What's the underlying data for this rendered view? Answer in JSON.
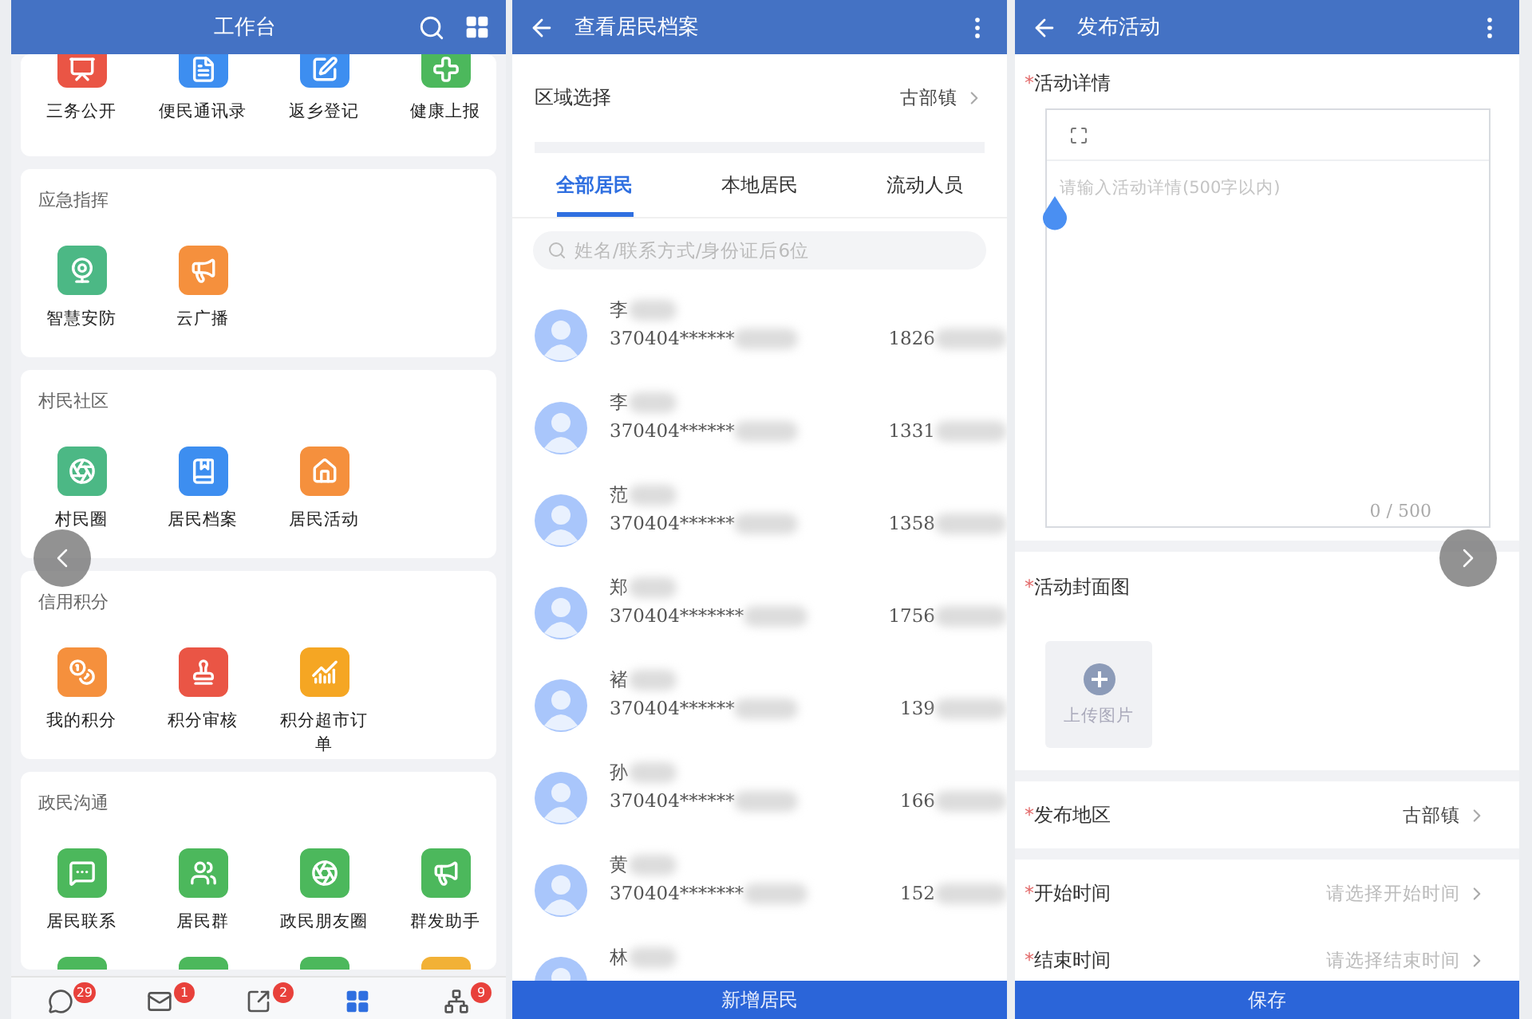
{
  "workbench": {
    "title": "工作台",
    "sections": [
      {
        "cut_top": true,
        "items": [
          {
            "label": "三务公开"
          },
          {
            "label": "便民通讯录"
          },
          {
            "label": "返乡登记"
          },
          {
            "label": "健康上报"
          }
        ]
      },
      {
        "title": "应急指挥",
        "items": [
          {
            "label": "智慧安防"
          },
          {
            "label": "云广播"
          }
        ]
      },
      {
        "title": "村民社区",
        "items": [
          {
            "label": "村民圈"
          },
          {
            "label": "居民档案"
          },
          {
            "label": "居民活动"
          }
        ]
      },
      {
        "title": "信用积分",
        "items": [
          {
            "label": "我的积分"
          },
          {
            "label": "积分审核"
          },
          {
            "label": "积分超市订单"
          }
        ]
      },
      {
        "title": "政民沟通",
        "items": [
          {
            "label": "居民联系"
          },
          {
            "label": "居民群"
          },
          {
            "label": "政民朋友圈"
          },
          {
            "label": "群发助手"
          }
        ],
        "cut_row": [
          {
            "color": "#4cb85c"
          },
          {
            "color": "#4cb85c"
          },
          {
            "color": "#4cb85c"
          },
          {
            "color": "#f2b136"
          }
        ]
      }
    ],
    "bottom_nav": [
      {
        "badge": "29",
        "selected": false
      },
      {
        "badge": "1",
        "selected": false
      },
      {
        "badge": "2",
        "selected": false
      },
      {
        "selected": true
      },
      {
        "badge": "9",
        "selected": false
      }
    ]
  },
  "residents": {
    "title": "查看居民档案",
    "region_label": "区域选择",
    "region_value": "古部镇",
    "tabs": [
      {
        "label": "全部居民",
        "selected": true
      },
      {
        "label": "本地居民",
        "selected": false
      },
      {
        "label": "流动人员",
        "selected": false
      }
    ],
    "search_placeholder": "姓名/联系方式/身份证后6位",
    "rows": [
      {
        "name": "李",
        "id": "370404******",
        "phone": "1826"
      },
      {
        "name": "李",
        "id": "370404******",
        "phone": "1331"
      },
      {
        "name": "范",
        "id": "370404******",
        "phone": "1358"
      },
      {
        "name": "郑",
        "id": "370404*******",
        "phone": "1756"
      },
      {
        "name": "褚",
        "id": "370404******",
        "phone": "139"
      },
      {
        "name": "孙",
        "id": "370404******",
        "phone": "166"
      },
      {
        "name": "黄",
        "id": "370404*******",
        "phone": "152"
      },
      {
        "name": "林"
      }
    ],
    "add_button": "新增居民"
  },
  "activity": {
    "title": "发布活动",
    "details_label": "活动详情",
    "details_placeholder": "请输入活动详情(500字以内)",
    "counter": "0 / 500",
    "cover_label": "活动封面图",
    "upload_label": "上传图片",
    "fields": [
      {
        "label": "发布地区",
        "value": "古部镇"
      },
      {
        "label": "开始时间",
        "placeholder": "请选择开始时间"
      },
      {
        "label": "结束时间",
        "placeholder": "请选择结束时间"
      }
    ],
    "required_mark": "*",
    "save_button": "保存"
  }
}
